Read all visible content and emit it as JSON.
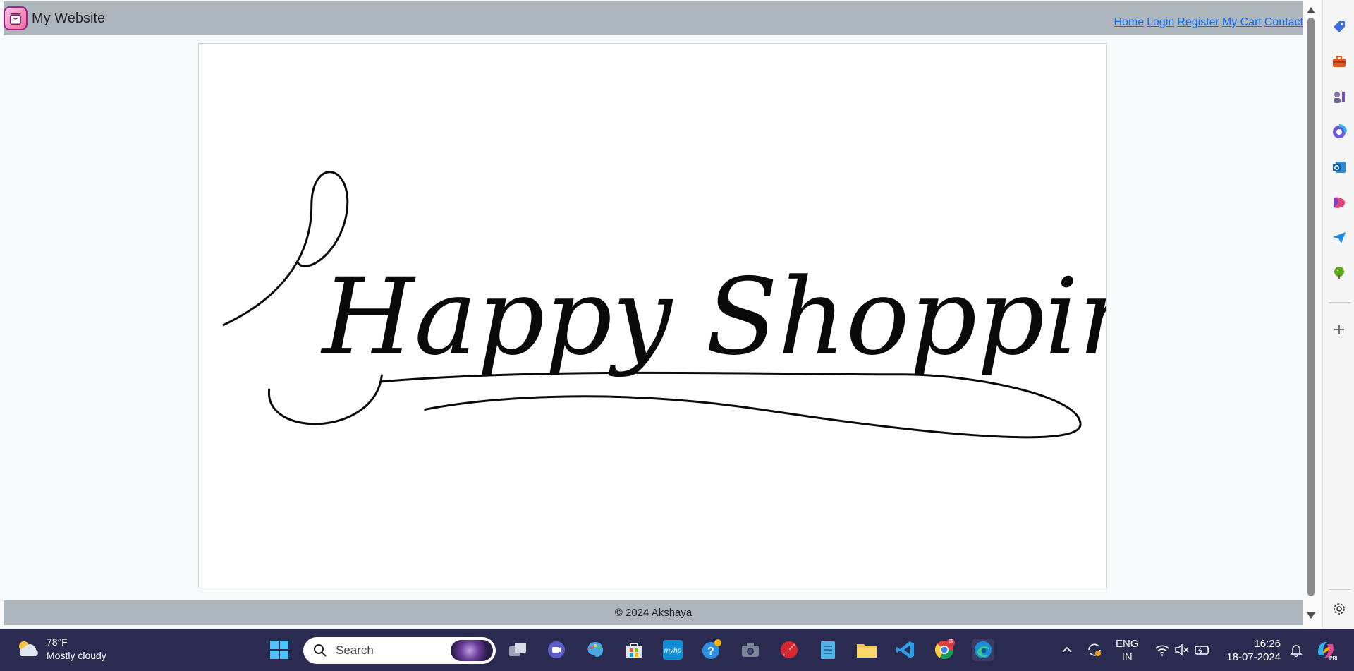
{
  "site": {
    "brand_name": "My Website",
    "nav": [
      {
        "label": "Home"
      },
      {
        "label": "Login"
      },
      {
        "label": "Register"
      },
      {
        "label": "My Cart"
      },
      {
        "label": "Contact"
      }
    ],
    "hero_text": "Happy Shopping",
    "footer": "© 2024 Akshaya"
  },
  "edge_sidebar": {
    "icons": [
      "tag-icon",
      "toolbox-icon",
      "games-icon",
      "copilot-icon",
      "outlook-icon",
      "designer-icon",
      "send-icon",
      "tree-icon",
      "add-icon",
      "settings-icon"
    ]
  },
  "taskbar": {
    "weather": {
      "temp": "78°F",
      "condition": "Mostly cloudy"
    },
    "search_placeholder": "Search",
    "chrome_badge": "8",
    "language": {
      "line1": "ENG",
      "line2": "IN"
    },
    "time": "16:26",
    "date": "18-07-2024"
  },
  "colors": {
    "header_bg": "#adb5bd",
    "link": "#0d6efd",
    "taskbar_bg": "#2b2b52"
  }
}
